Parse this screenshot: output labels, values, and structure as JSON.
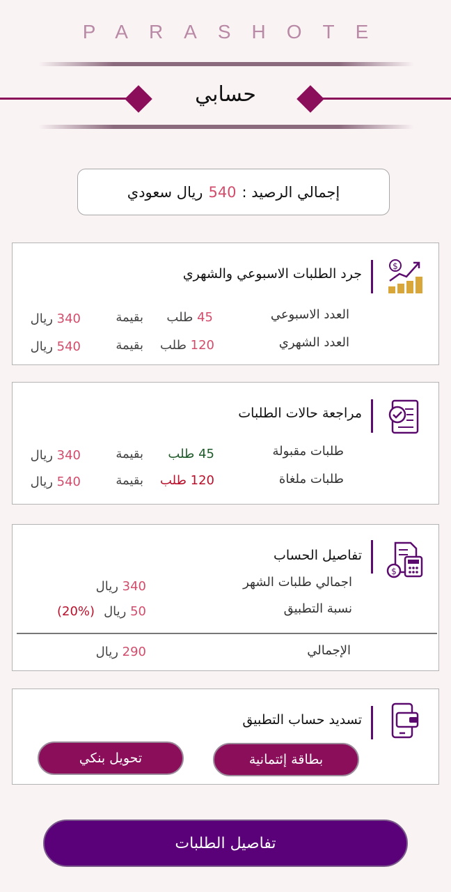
{
  "brand": "PARASHOTE",
  "page_title": "حسابي",
  "balance": {
    "label": "إجمالي الرصيد :",
    "amount": "540",
    "currency": "ريال سعودي"
  },
  "inventory_card": {
    "title": "جرد الطلبات الاسبوعي والشهري",
    "icon": "growth-chart-icon",
    "rows": [
      {
        "label": "العدد الاسبوعي",
        "count": "45",
        "count_unit": "طلب",
        "value_label": "بقيمة",
        "amount": "340",
        "currency": "ريال"
      },
      {
        "label": "العدد الشهري",
        "count": "120",
        "count_unit": "طلب",
        "value_label": "بقيمة",
        "amount": "540",
        "currency": "ريال"
      }
    ]
  },
  "status_card": {
    "title": "مراجعة حالات الطلبات",
    "icon": "checked-document-icon",
    "rows": [
      {
        "label": "طلبات مقبولة",
        "count": "45",
        "count_unit": "طلب",
        "value_label": "بقيمة",
        "amount": "340",
        "currency": "ريال"
      },
      {
        "label": "طلبات ملغاة",
        "count": "120",
        "count_unit": "طلب",
        "value_label": "بقيمة",
        "amount": "540",
        "currency": "ريال"
      }
    ]
  },
  "account_card": {
    "title": "تفاصيل الحساب",
    "icon": "calculator-invoice-icon",
    "monthly_label": "اجمالي طلبات الشهر",
    "monthly_amount": "340",
    "monthly_currency": "ريال",
    "fee_label": "نسبة التطبيق",
    "fee_amount": "50",
    "fee_currency": "ريال",
    "fee_percent": "(20%)",
    "total_label": "الإجمالي",
    "total_amount": "290",
    "total_currency": "ريال"
  },
  "payment_card": {
    "title": "تسديد حساب التطبيق",
    "icon": "mobile-wallet-icon",
    "credit_button": "بطاقة إئتمانية",
    "bank_button": "تحويل بنكي"
  },
  "orders_button": "تفاصيل الطلبات",
  "colors": {
    "background": "#faf3f4",
    "primary": "#8b0e5a",
    "purple": "#5a0078",
    "accent_pink": "#d24d6c",
    "accepted_green": "#1e5a2a",
    "cancelled_red": "#b8112c"
  }
}
